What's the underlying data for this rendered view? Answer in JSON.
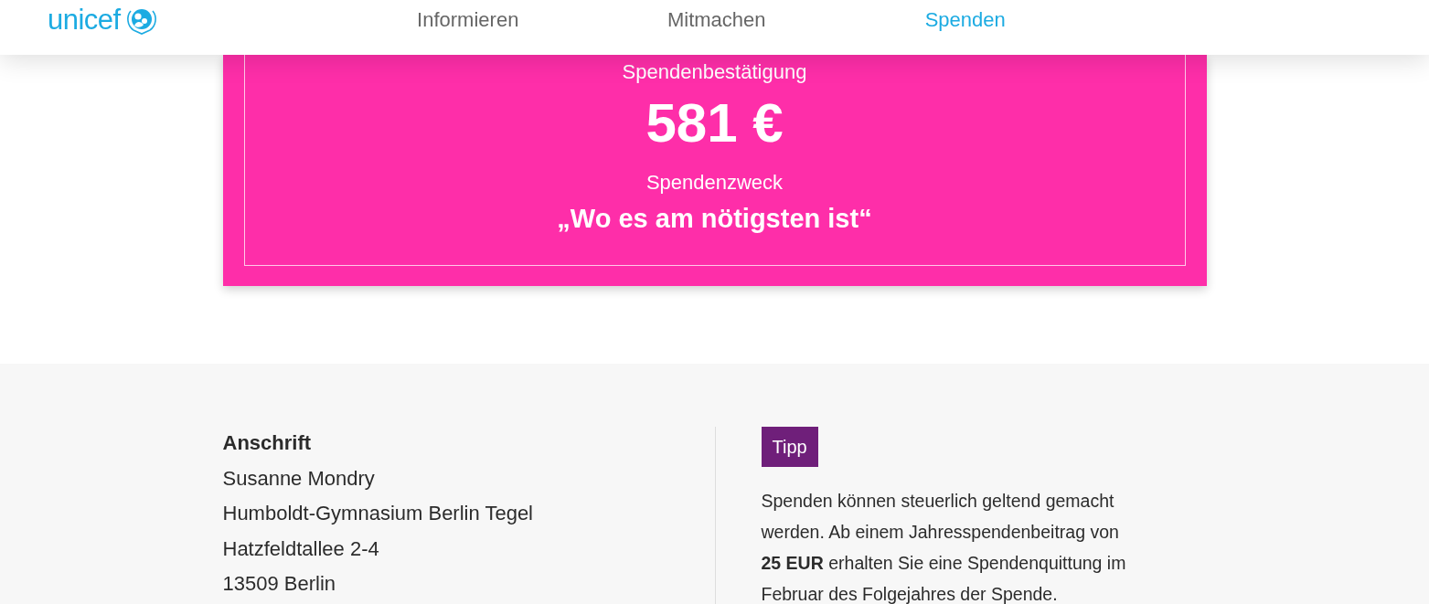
{
  "header": {
    "logo": {
      "text": "unicef"
    },
    "nav": [
      {
        "label": "Informieren",
        "selected": false
      },
      {
        "label": "Mitmachen",
        "selected": false
      },
      {
        "label": "Spenden",
        "selected": true
      }
    ]
  },
  "confirmation_card": {
    "title": "Spendenbestätigung",
    "amount": "581 €",
    "purpose_label": "Spendenzweck",
    "purpose": "„Wo es am nötigsten ist“"
  },
  "address": {
    "heading": "Anschrift",
    "lines": [
      "Susanne Mondry",
      "Humboldt-Gymnasium Berlin Tegel",
      "Hatzfeldtallee 2-4",
      "13509 Berlin"
    ]
  },
  "tip": {
    "badge": "Tipp",
    "text": "Spenden können steuerlich geltend gemacht werden. Ab einem Jahresspendenbeitrag von **25 EUR** erhalten Sie eine Spendenquittung im Februar des Folgejahres der Spende."
  }
}
